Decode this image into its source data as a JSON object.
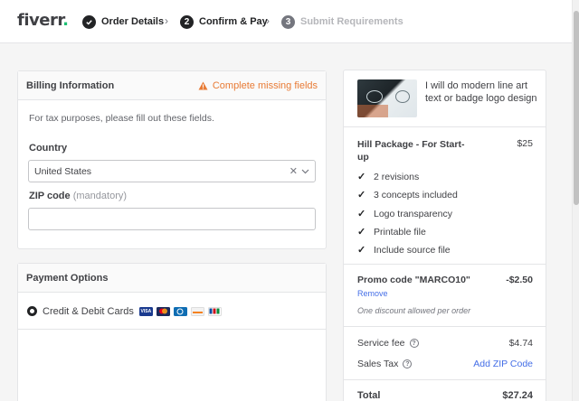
{
  "header": {
    "logo_text": "fiverr",
    "logo_dot": ".",
    "steps": [
      {
        "num": "",
        "label": "Order Details",
        "state": "done"
      },
      {
        "num": "2",
        "label": "Confirm & Pay",
        "state": "active"
      },
      {
        "num": "3",
        "label": "Submit Requirements",
        "state": "inactive"
      }
    ],
    "separator": "›"
  },
  "billing": {
    "title": "Billing Information",
    "warning": "Complete missing fields",
    "tax_note": "For tax purposes, please fill out these fields.",
    "country_label": "Country",
    "country_value": "United States",
    "zip_label": "ZIP code",
    "zip_optional": "(mandatory)",
    "zip_value": ""
  },
  "payment": {
    "title": "Payment Options",
    "method_label": "Credit & Debit Cards",
    "cards": [
      "visa-icon",
      "mastercard-icon",
      "diners-icon",
      "discover-icon",
      "jcb-icon"
    ]
  },
  "summary": {
    "gig_title": "I will do modern line art text or badge logo design",
    "package_name": "Hill Package - For Start-up",
    "package_price": "$25",
    "features": [
      "2 revisions",
      "3 concepts included",
      "Logo transparency",
      "Printable file",
      "Include source file"
    ],
    "promo_label": "Promo code \"MARCO10\"",
    "promo_value": "-$2.50",
    "remove_label": "Remove",
    "discount_note": "One discount allowed per order",
    "service_fee_label": "Service fee",
    "service_fee_value": "$4.74",
    "sales_tax_label": "Sales Tax",
    "add_zip_label": "Add ZIP Code",
    "total_label": "Total",
    "total_value": "$27.24"
  },
  "colors": {
    "brand_green": "#1dbf73",
    "warning_orange": "#e87b35",
    "link_blue": "#446ee7"
  }
}
